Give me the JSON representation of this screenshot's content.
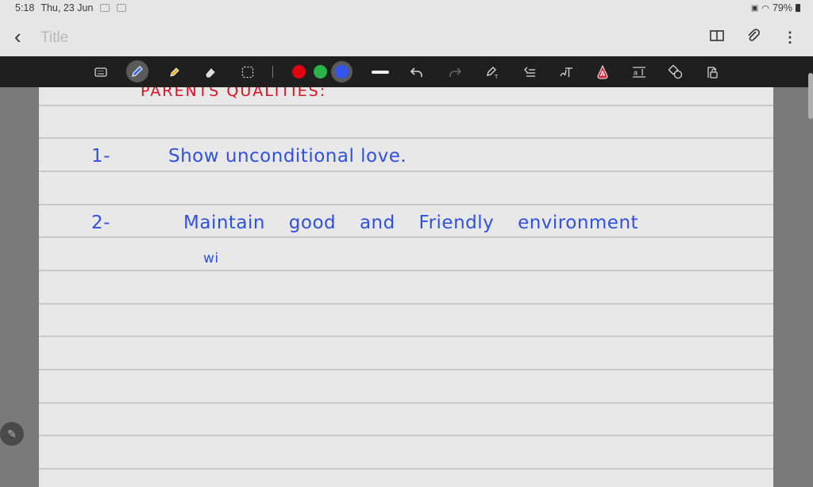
{
  "status_bar": {
    "time": "5:18",
    "date": "Thu, 23 Jun",
    "battery": "79%"
  },
  "app_bar": {
    "title": "Title",
    "back_icon": "chevron-left",
    "actions": [
      "book-icon",
      "paperclip-icon",
      "more-vert-icon"
    ]
  },
  "toolbar": {
    "tools": [
      "keyboard",
      "pen",
      "highlighter",
      "eraser",
      "lasso-select",
      "color-red",
      "color-green",
      "color-blue",
      "stroke-width",
      "undo",
      "redo",
      "pen-to-text",
      "straighten",
      "text-mode",
      "text-color",
      "text-spacing",
      "shapes",
      "lock"
    ],
    "active_tool": "pen",
    "colors": {
      "red": "#e00010",
      "green": "#29b34a",
      "blue": "#3355ee"
    },
    "selected_color": "blue"
  },
  "note": {
    "heading": "PARENTS  QUALITIES:",
    "lines": [
      {
        "number": "1-",
        "text": "Show  unconditional  love."
      },
      {
        "number": "2-",
        "text": "Maintain  good  and  Friendly  environment"
      },
      {
        "number": "",
        "text": "wi"
      }
    ]
  }
}
